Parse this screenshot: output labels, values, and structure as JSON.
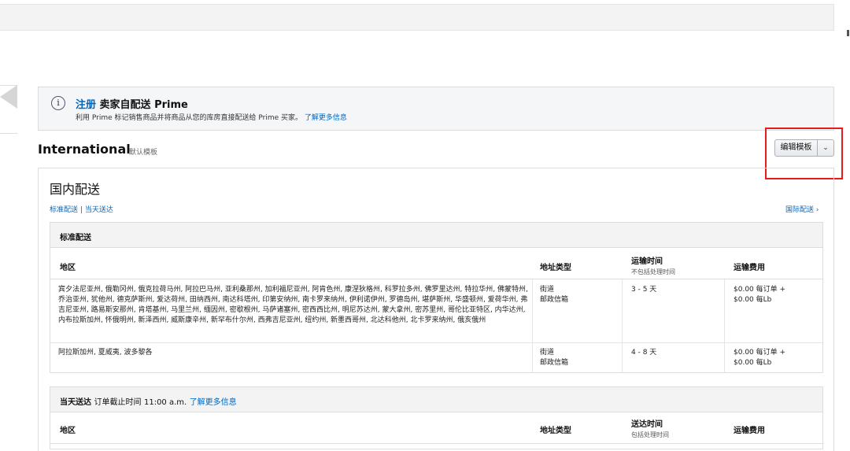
{
  "prime_banner": {
    "info_icon": "info-icon",
    "register_link": "注册",
    "title": "卖家自配送 Prime",
    "description": "利用 Prime 标记销售商品并将商品从您的库房直接配送给 Prime 买家。",
    "learn_more": "了解更多信息"
  },
  "template": {
    "name": "International",
    "default_label": "默认模板",
    "edit_button": "编辑模板",
    "dropdown_icon": "chevron-down-icon"
  },
  "domestic": {
    "title": "国内配送",
    "link_standard": "标准配送",
    "separator": "|",
    "link_same_day": "当天送达",
    "link_international": "国际配送 ›"
  },
  "standard": {
    "section_title": "标准配送",
    "headers": {
      "region": "地区",
      "address_type": "地址类型",
      "transit_time": "运输时间",
      "transit_note": "不包括处理时间",
      "shipping_fee": "运输费用"
    },
    "rows": [
      {
        "region": "宾夕法尼亚州, 俄勒冈州, 俄克拉荷马州, 阿拉巴马州, 亚利桑那州, 加利福尼亚州, 阿肯色州, 康涅狄格州, 科罗拉多州, 佛罗里达州, 特拉华州, 佛蒙特州, 乔治亚州, 犹他州, 德克萨斯州, 爱达荷州, 田纳西州, 南达科塔州, 印第安纳州, 南卡罗来纳州, 伊利诺伊州, 罗德岛州, 堪萨斯州, 华盛顿州, 爱荷华州, 弗吉尼亚州, 路易斯安那州, 肯塔基州, 马里兰州, 缅因州, 密歇根州, 马萨诸塞州, 密西西比州, 明尼苏达州, 蒙大拿州, 密苏里州, 哥伦比亚特区, 内华达州, 内布拉斯加州, 怀俄明州, 新泽西州, 威斯康辛州, 新罕布什尔州, 西弗吉尼亚州, 纽约州, 新墨西哥州, 北达科他州, 北卡罗来纳州, 俄亥俄州",
        "address_line1": "街道",
        "address_line2": "邮政信箱",
        "transit": "3 - 5 天",
        "fee_line1": "$0.00 每订单 +",
        "fee_line2": "$0.00 每Lb"
      },
      {
        "region": "阿拉斯加州, 夏威夷, 波多黎各",
        "address_line1": "街道",
        "address_line2": "邮政信箱",
        "transit": "4 - 8 天",
        "fee_line1": "$0.00 每订单 +",
        "fee_line2": "$0.00 每Lb"
      }
    ]
  },
  "same_day": {
    "section_title": "当天送达",
    "cutoff_label": "订单截止时间",
    "cutoff_time": "11:00 a.m.",
    "learn_more": "了解更多信息",
    "headers": {
      "region": "地区",
      "address_type": "地址类型",
      "delivery_time": "送达时间",
      "delivery_note": "包括处理时间",
      "shipping_fee": "运输费用"
    }
  }
}
